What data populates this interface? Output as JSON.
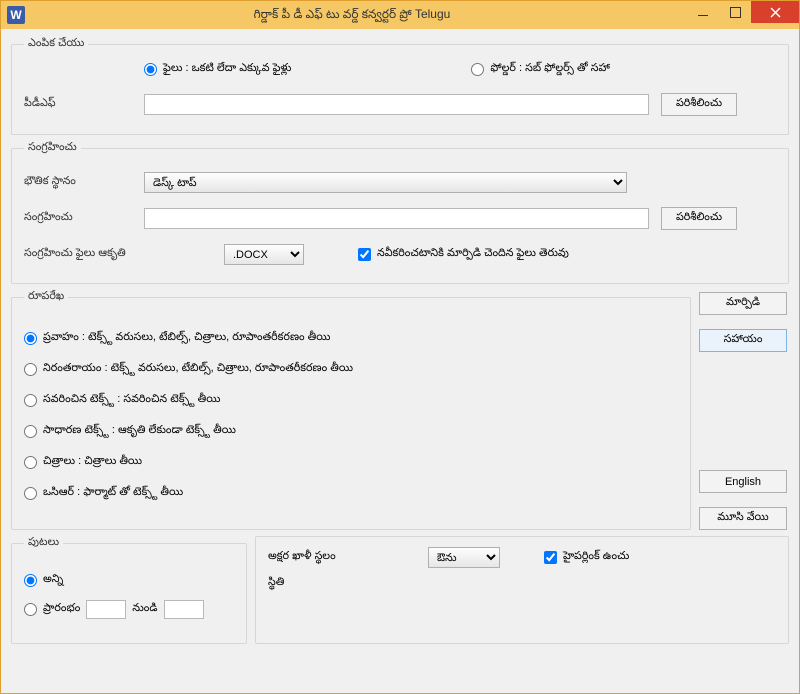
{
  "window": {
    "title": "గిర్డాక్ పీ డీ ఎఫ్ టు వర్డ్  కన్వర్టర్ ప్రో Telugu"
  },
  "section_select": {
    "legend": "ఎంపిక చేయు",
    "radio_files": "ఫైలు : ఒకటి లేదా ఎక్కువ ఫైళ్లు",
    "radio_folder": "ఫోల్డర్ : సబ్ ఫోల్డర్స్ తో సహా",
    "pdf_label": "పీడీఎఫ్",
    "pdf_value": "",
    "browse": "పరిశీలించు"
  },
  "section_save": {
    "legend": "సంగ్రహించు",
    "location_label": "భౌతిక స్థానం",
    "location_value": "డెస్క్ టాప్",
    "save_label": "సంగ్రహించు",
    "save_value": "",
    "browse": "పరిశీలించు",
    "format_label": "సంగ్రహించు ఫైలు ఆకృతి",
    "format_value": ".DOCX",
    "open_after": "నవీకరించటానికి మార్పిడి చెందిన ఫైలు తెరువు"
  },
  "section_layout": {
    "legend": "రూపరేఖ",
    "opt_flowing": "ప్రవాహం : టెక్స్ట్ వరుసలు, టేబిల్స్, చిత్రాలు, రూపాంతరీకరణం తీయి",
    "opt_continuous": "నిరంతరాయం : టెక్స్ట్ వరుసలు, టేబిల్స్, చిత్రాలు, రూపాంతరీకరణం తీయి",
    "opt_formatted": "సవరించిన టెక్స్ట్ : సవరించిన టెక్స్ట్ తీయి",
    "opt_plain": "సాధారణ టెక్స్ట్ : ఆకృతి లేకుండా టెక్స్ట్ తీయి",
    "opt_images": "చిత్రాలు : చిత్రాలు తీయి",
    "opt_ocr": "ఒసిఆర్ : ఫార్మాట్ తో టెక్స్ట్ తీయి"
  },
  "right_buttons": {
    "convert": "మార్పిడి",
    "help": "సహాయం",
    "english": "English",
    "close": "మూసి వేయి"
  },
  "section_pages": {
    "legend": "పుటలు",
    "all": "అన్ని",
    "start": "ప్రారంభం",
    "to": "నుండి",
    "from_val": "",
    "to_val": ""
  },
  "section_misc": {
    "charspace_label": "అక్షర ఖాళీ స్థలం",
    "charspace_value": "ఔను",
    "hyperlink": "హైపర్లింక్ ఉంచు",
    "progress_label": "స్థితి"
  }
}
